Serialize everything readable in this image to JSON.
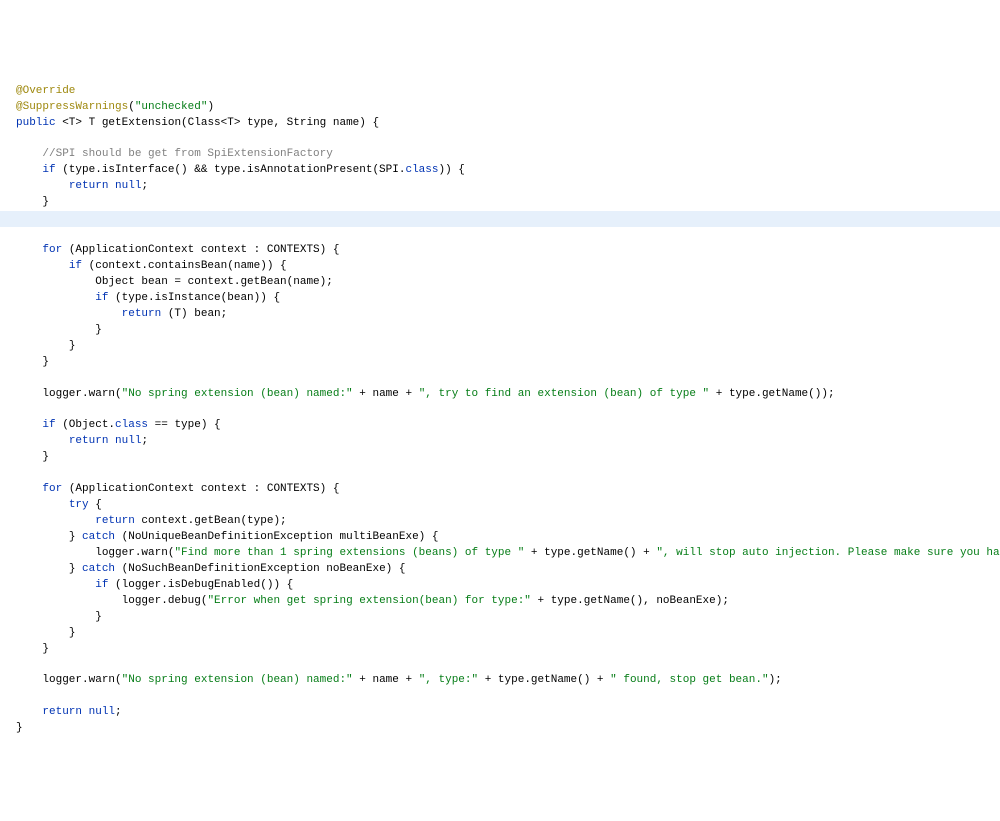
{
  "code": {
    "l1": "@Override",
    "l2_ann": "@SuppressWarnings",
    "l2_str": "\"unchecked\"",
    "l3_kw1": "public",
    "l3_gen": " <T> T ",
    "l3_fn": "getExtension",
    "l3_sig": "(Class<T> type, String name) {",
    "l5_cm": "//SPI should be get from SpiExtensionFactory",
    "l6_kw": "if",
    "l6_cond": " (type.isInterface() && type.isAnnotationPresent(SPI.",
    "l6_kw2": "class",
    "l6_tail": ")) {",
    "l7_kw": "return null",
    "l7_tail": ";",
    "l8": "}",
    "l10_kw": "for",
    "l10_cond": " (ApplicationContext context : CONTEXTS) {",
    "l11_kw": "if",
    "l11_cond": " (context.containsBean(name)) {",
    "l12": "Object bean = context.getBean(name);",
    "l13_kw": "if",
    "l13_cond": " (type.isInstance(bean)) {",
    "l14_kw": "return",
    "l14_tail": " (T) bean;",
    "l15": "}",
    "l16": "}",
    "l17": "}",
    "l19_pre": "logger.warn(",
    "l19_s1": "\"No spring extension (bean) named:\"",
    "l19_mid1": " + name + ",
    "l19_s2": "\", try to find an extension (bean) of type \"",
    "l19_mid2": " + type.getName());",
    "l21_kw": "if",
    "l21_cond": " (Object.",
    "l21_kw2": "class",
    "l21_tail": " == type) {",
    "l22_kw": "return null",
    "l22_tail": ";",
    "l23": "}",
    "l25_kw": "for",
    "l25_cond": " (ApplicationContext context : CONTEXTS) {",
    "l26_kw": "try",
    "l26_tail": " {",
    "l27_kw": "return",
    "l27_tail": " context.getBean(type);",
    "l28a": "} ",
    "l28_kw": "catch",
    "l28b": " (NoUniqueBeanDefinitionException multiBeanExe) {",
    "l29_pre": "logger.warn(",
    "l29_s1": "\"Find more than 1 spring extensions (beans) of type \"",
    "l29_mid": " + type.getName() + ",
    "l29_s2": "\", will stop auto injection. Please make sure you hav",
    "l30a": "} ",
    "l30_kw": "catch",
    "l30b": " (NoSuchBeanDefinitionException noBeanExe) {",
    "l31_kw": "if",
    "l31_cond": " (logger.isDebugEnabled()) {",
    "l32_pre": "logger.debug(",
    "l32_s1": "\"Error when get spring extension(bean) for type:\"",
    "l32_tail": " + type.getName(), noBeanExe);",
    "l33": "}",
    "l34": "}",
    "l35": "}",
    "l37_pre": "logger.warn(",
    "l37_s1": "\"No spring extension (bean) named:\"",
    "l37_m1": " + name + ",
    "l37_s2": "\", type:\"",
    "l37_m2": " + type.getName() + ",
    "l37_s3": "\" found, stop get bean.\"",
    "l37_tail": ");",
    "l39_kw": "return null",
    "l39_tail": ";",
    "l40": "}"
  }
}
